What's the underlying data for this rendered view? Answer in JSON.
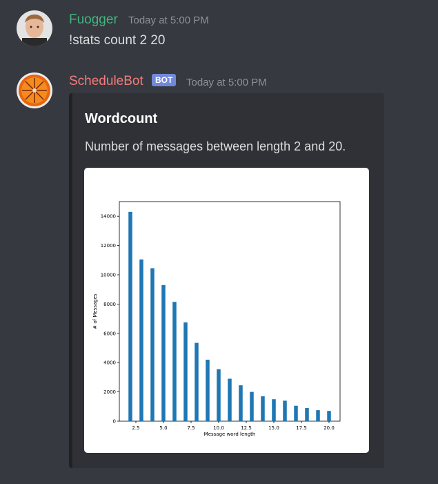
{
  "messages": [
    {
      "username": "Fuogger",
      "username_color": "#43b581",
      "timestamp": "Today at 5:00 PM",
      "content": "!stats count 2 20"
    },
    {
      "username": "ScheduleBot",
      "username_color": "#f47b7b",
      "badge": "BOT",
      "timestamp": "Today at 5:00 PM",
      "embed": {
        "title": "Wordcount",
        "description": "Number of messages between length 2 and 20."
      }
    }
  ],
  "chart_data": {
    "type": "bar",
    "xlabel": "Message word length",
    "ylabel": "# of Messages",
    "x": [
      2,
      3,
      4,
      5,
      6,
      7,
      8,
      9,
      10,
      11,
      12,
      13,
      14,
      15,
      16,
      17,
      18,
      19,
      20
    ],
    "values": [
      14300,
      11050,
      10450,
      9300,
      8150,
      6750,
      5350,
      4200,
      3550,
      2900,
      2450,
      2000,
      1700,
      1500,
      1400,
      1050,
      900,
      750,
      700
    ],
    "xlim": [
      1,
      21
    ],
    "ylim": [
      0,
      15000
    ],
    "xticks": [
      2.5,
      5.0,
      7.5,
      10.0,
      12.5,
      15.0,
      17.5,
      20.0
    ],
    "xtick_labels": [
      "2.5",
      "5.0",
      "7.5",
      "10.0",
      "12.5",
      "15.0",
      "17.5",
      "20.0"
    ],
    "yticks": [
      0,
      2000,
      4000,
      6000,
      8000,
      10000,
      12000,
      14000
    ],
    "ytick_labels": [
      "0",
      "2000",
      "4000",
      "6000",
      "8000",
      "10000",
      "12000",
      "14000"
    ],
    "bar_color": "#1f77b4",
    "grid": false
  }
}
